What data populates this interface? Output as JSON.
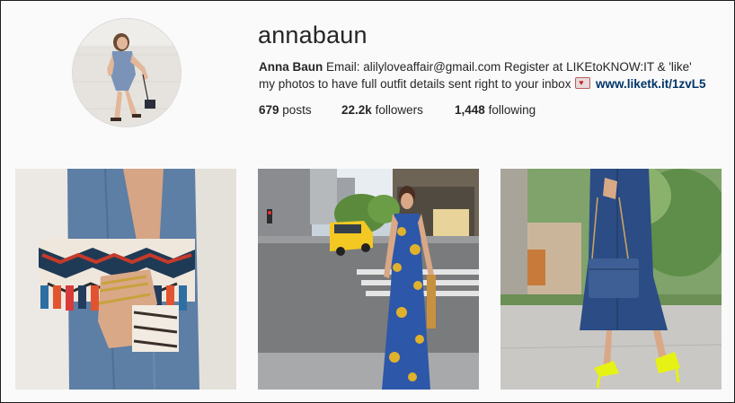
{
  "profile": {
    "username": "annabaun",
    "full_name": "Anna Baun",
    "bio_text": " Email: alilyloveaffair@gmail.com Register at LIKEtoKNOW:IT & 'like' my photos to have full outfit details sent right to your inbox",
    "bio_icon": "love-letter-emoji",
    "link": "www.liketk.it/1zvL5"
  },
  "stats": {
    "posts_count": "679",
    "posts_label": "posts",
    "followers_count": "22.2k",
    "followers_label": "followers",
    "following_count": "1,448",
    "following_label": "following"
  },
  "colors": {
    "link": "#003569",
    "background": "#fafafa"
  }
}
